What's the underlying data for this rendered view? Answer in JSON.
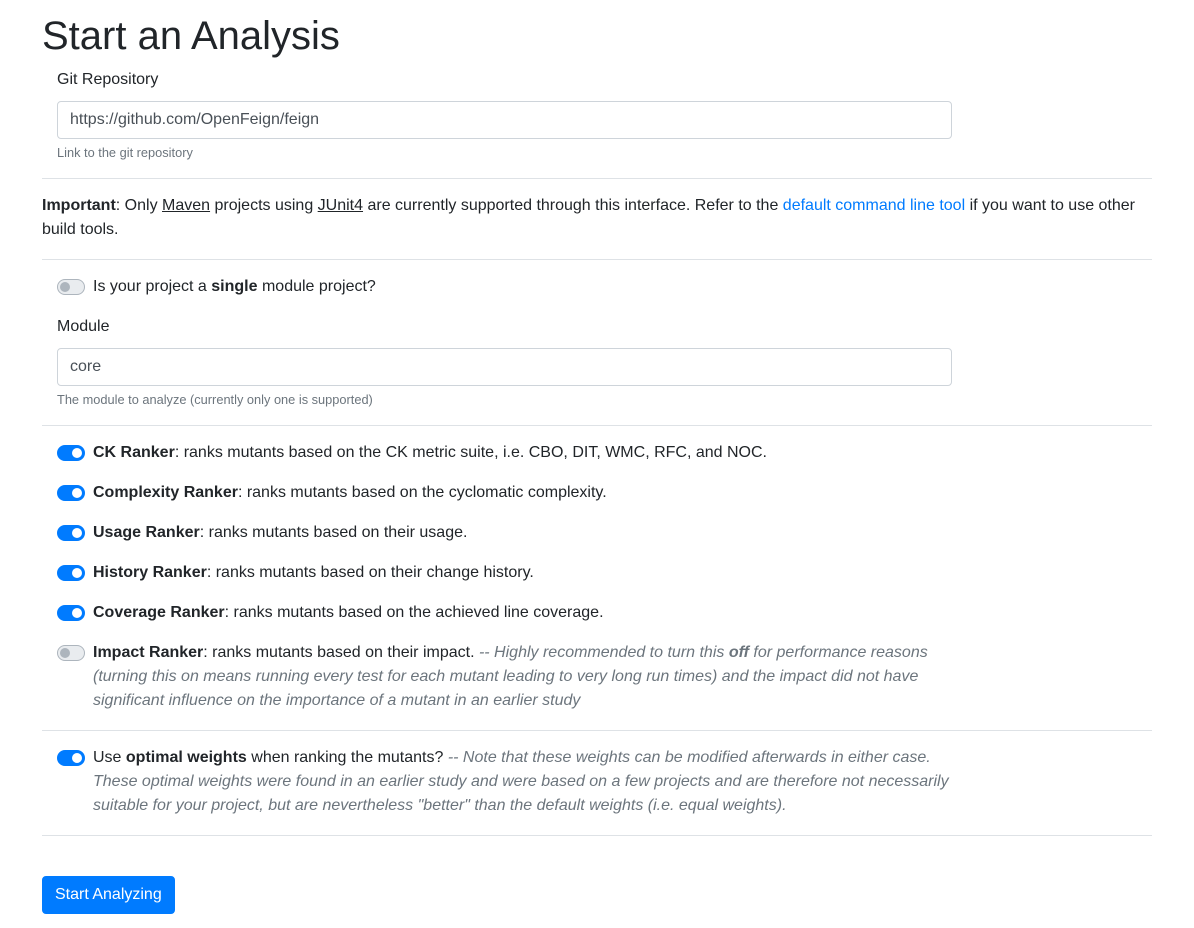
{
  "page": {
    "title": "Start an Analysis"
  },
  "repo": {
    "label": "Git Repository",
    "value": "https://github.com/OpenFeign/feign",
    "help": "Link to the git repository"
  },
  "important": {
    "bold": "Important",
    "t1": ": Only ",
    "maven": "Maven",
    "t2": " projects using ",
    "junit": "JUnit4",
    "t3": " are currently supported through this interface. Refer to the ",
    "link": "default command line tool",
    "t4": " if you want to use other build tools."
  },
  "single_module": {
    "enabled": false,
    "pre": "Is your project a ",
    "bold": "single",
    "post": " module project?"
  },
  "module": {
    "label": "Module",
    "value": "core",
    "help": "The module to analyze (currently only one is supported)"
  },
  "rankers": [
    {
      "name": "CK Ranker",
      "desc": ": ranks mutants based on the CK metric suite, i.e. CBO, DIT, WMC, RFC, and NOC.",
      "enabled": true
    },
    {
      "name": "Complexity Ranker",
      "desc": ": ranks mutants based on the cyclomatic complexity.",
      "enabled": true
    },
    {
      "name": "Usage Ranker",
      "desc": ": ranks mutants based on their usage.",
      "enabled": true
    },
    {
      "name": "History Ranker",
      "desc": ": ranks mutants based on their change history.",
      "enabled": true
    },
    {
      "name": "Coverage Ranker",
      "desc": ": ranks mutants based on the achieved line coverage.",
      "enabled": true
    },
    {
      "name": "Impact Ranker",
      "desc": ": ranks mutants based on their impact. ",
      "enabled": false,
      "note_pre": "-- Highly recommended to turn this ",
      "note_bold": "off",
      "note_post": " for performance reasons (turning this on means running every test for each mutant leading to very long run times) and the impact did not have significant influence on the importance of a mutant in an earlier study"
    }
  ],
  "weights": {
    "enabled": true,
    "pre": "Use ",
    "bold": "optimal weights",
    "post": " when ranking the mutants? ",
    "note": "-- Note that these weights can be modified afterwards in either case. These optimal weights were found in an earlier study and were based on a few projects and are therefore not necessarily suitable for your project, but are nevertheless \"better\" than the default weights (i.e. equal weights)."
  },
  "submit": {
    "label": "Start Analyzing"
  },
  "colors": {
    "primary": "#007bff",
    "muted": "#6c757d",
    "border": "#dee2e6"
  }
}
